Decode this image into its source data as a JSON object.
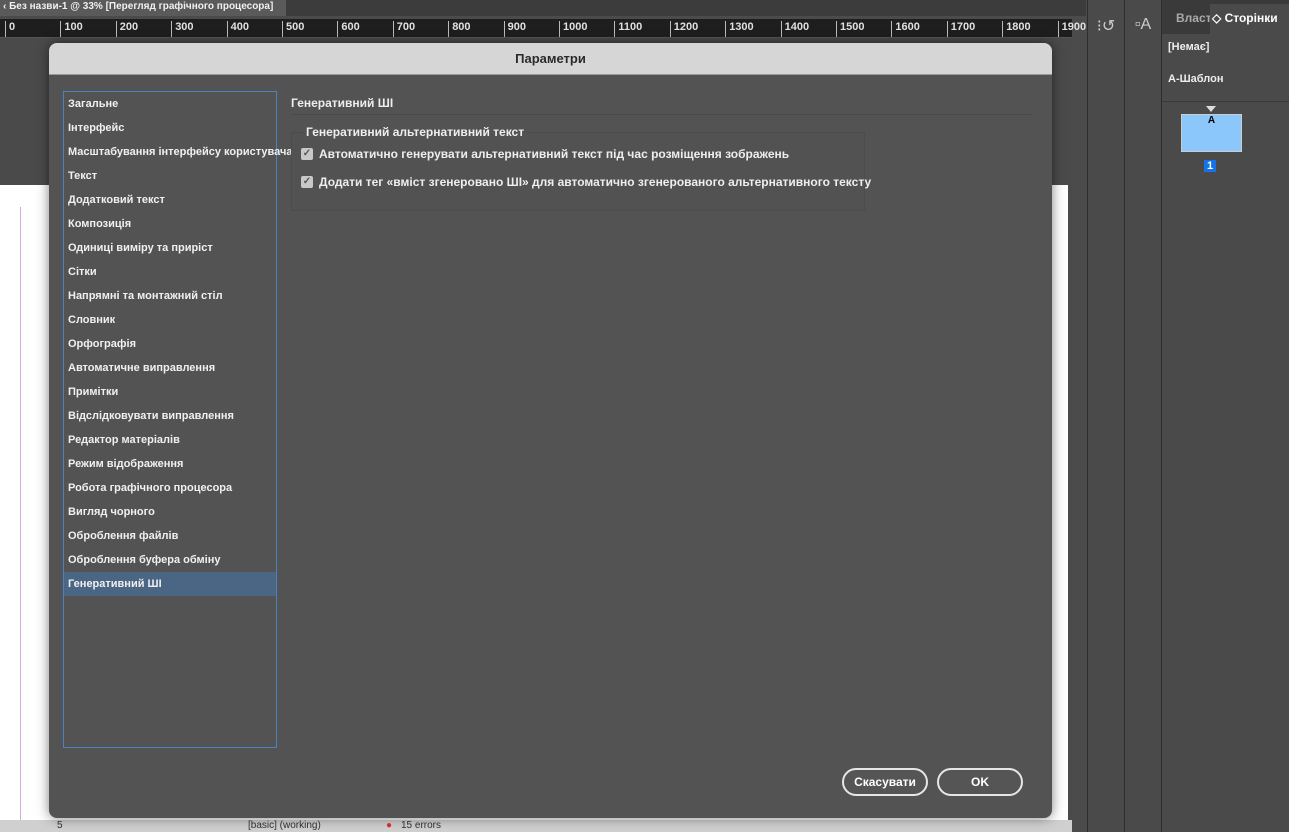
{
  "app": {
    "doc_tab": "‹  Без назви-1 @ 33% [Перегляд графічного процесора]",
    "ruler": [
      "0",
      "100",
      "200",
      "300",
      "400",
      "500",
      "600",
      "700",
      "800",
      "900",
      "1000",
      "1100",
      "1200",
      "1300",
      "1400",
      "1500",
      "1600",
      "1700",
      "1800",
      "1900"
    ],
    "status": {
      "page": "5",
      "style": "[basic] (working)",
      "errors": "15 errors"
    }
  },
  "panel": {
    "tab_inactive": "Власт",
    "tab_active": "◇ Сторінки",
    "none": "[Немає]",
    "master": "A-Шаблон",
    "thumb_letter": "A",
    "page_number": "1"
  },
  "dialog": {
    "title": "Параметри",
    "categories": [
      "Загальне",
      "Інтерфейс",
      "Масштабування інтерфейсу користувача",
      "Текст",
      "Додатковий текст",
      "Композиція",
      "Одиниці виміру та приріст",
      "Сітки",
      "Напрямні та монтажний стіл",
      "Словник",
      "Орфографія",
      "Автоматичне виправлення",
      "Примітки",
      "Відслідковувати виправлення",
      "Редактор матеріалів",
      "Режим відображення",
      "Робота графічного процесора",
      "Вигляд чорного",
      "Оброблення файлів",
      "Оброблення буфера обміну",
      "Генеративний ШІ"
    ],
    "selected": "Генеративний ШІ",
    "section_title": "Генеративний ШІ",
    "group_title": "Генеративний альтернативний текст",
    "options": [
      {
        "label": "Автоматично генерувати альтернативний текст під час розміщення зображень",
        "checked": true
      },
      {
        "label": "Додати тег «вміст згенеровано ШІ» для автоматично згенерованого альтернативного тексту",
        "checked": true
      }
    ],
    "cancel": "Скасувати",
    "ok": "OK"
  }
}
